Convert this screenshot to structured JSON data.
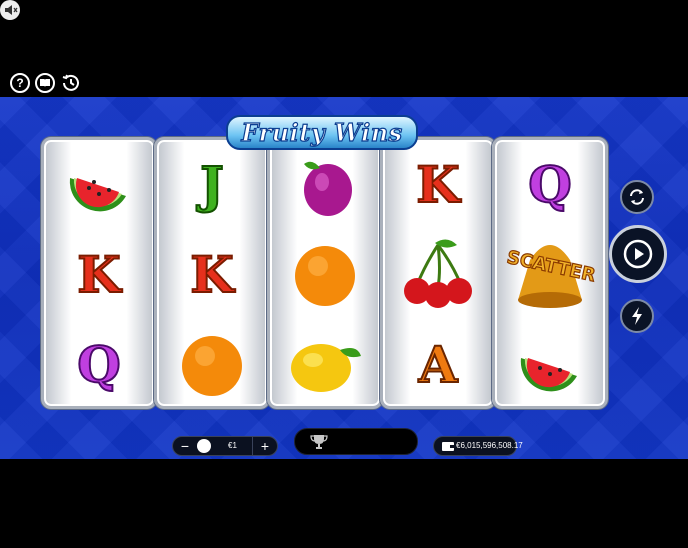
{
  "game": {
    "title": "Fruity Wins"
  },
  "toolbar": {
    "help_icon": "question-icon",
    "paytable_icon": "book-icon",
    "history_icon": "history-icon",
    "sound_icon": "speaker-mute-icon"
  },
  "reels": [
    [
      "watermelon",
      "K",
      "Q"
    ],
    [
      "J",
      "K",
      "orange"
    ],
    [
      "plum",
      "orange",
      "lemon"
    ],
    [
      "K",
      "cherries",
      "A"
    ],
    [
      "Q",
      "scatter-bell",
      "watermelon"
    ]
  ],
  "symbols": {
    "scatter_label": "SCATTER"
  },
  "controls": {
    "autospin_icon": "refresh-icon",
    "spin_icon": "play-icon",
    "turbo_icon": "lightning-icon"
  },
  "bet": {
    "minus": "−",
    "plus": "+",
    "value": "€1"
  },
  "balance": {
    "value": "€6,015,596,508.17"
  },
  "colors": {
    "background_blue": "#1236c6",
    "reel_white": "#ffffff",
    "k_red": "#e6301c",
    "q_purple": "#c03fe0",
    "j_green": "#3fb21f",
    "a_orange": "#f07a10"
  }
}
